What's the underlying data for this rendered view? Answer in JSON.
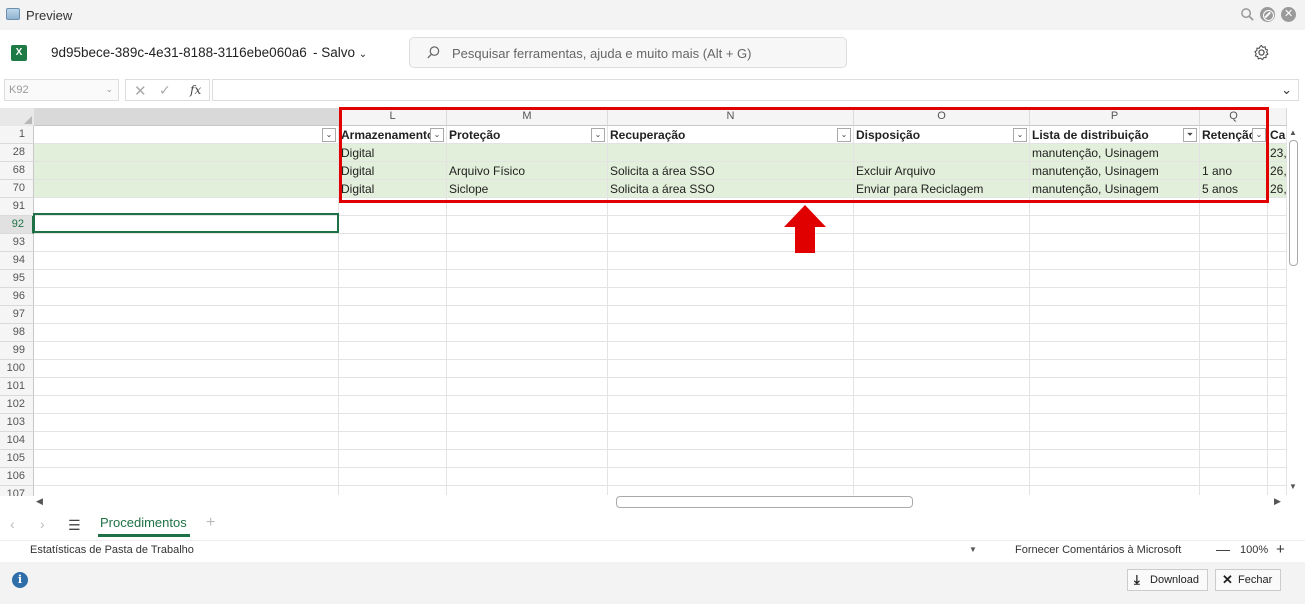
{
  "window": {
    "title": "Preview"
  },
  "header": {
    "file_name": "9d95bece-389c-4e31-8188-3116ebe060a6",
    "save_state": "-  Salvo",
    "search_placeholder": "Pesquisar ferramentas, ajuda e muito mais (Alt + G)"
  },
  "formula_bar": {
    "name_box": "K92",
    "fx": "fx",
    "value": ""
  },
  "columns": [
    {
      "letter": "L",
      "header": "Armazenamento"
    },
    {
      "letter": "M",
      "header": "Proteção"
    },
    {
      "letter": "N",
      "header": "Recuperação"
    },
    {
      "letter": "O",
      "header": "Disposição"
    },
    {
      "letter": "P",
      "header": "Lista de distribuição"
    },
    {
      "letter": "Q",
      "header": "Retenção"
    },
    {
      "letter": "",
      "header": "Ca"
    }
  ],
  "header_row_number": "1",
  "data_rows": [
    {
      "num": "28",
      "cells": [
        "Digital",
        "",
        "",
        "",
        "manutenção, Usinagem",
        "",
        "23,"
      ]
    },
    {
      "num": "68",
      "cells": [
        "Digital",
        "Arquivo Físico",
        "Solicita a área SSO",
        "Excluir Arquivo",
        "manutenção, Usinagem",
        "1 ano",
        "26,"
      ]
    },
    {
      "num": "70",
      "cells": [
        "Digital",
        "Siclope",
        "Solicita a área SSO",
        "Enviar para Reciclagem",
        "manutenção, Usinagem",
        "5 anos",
        "26,"
      ]
    }
  ],
  "empty_rows": [
    "91",
    "92",
    "93",
    "94",
    "95",
    "96",
    "97",
    "98",
    "99",
    "100",
    "101",
    "102",
    "103",
    "104",
    "105",
    "106",
    "107"
  ],
  "active_row": "92",
  "sheet_tabs": {
    "active": "Procedimentos"
  },
  "status_bar": {
    "stats": "Estatísticas de Pasta de Trabalho",
    "feedback": "Fornecer Comentários à Microsoft",
    "zoom": "100%"
  },
  "footer": {
    "download_label": "Download",
    "close_label": "Fechar"
  },
  "colors": {
    "accent": "#1e7145",
    "highlight": "#e10000",
    "filtered_row": "#e2efda"
  }
}
